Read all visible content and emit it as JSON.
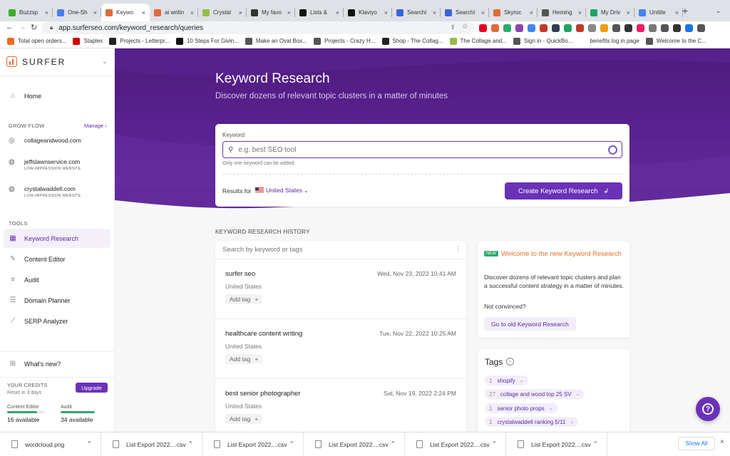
{
  "browser": {
    "tabs": [
      {
        "title": "Buzzsp",
        "color": "#3dae2b"
      },
      {
        "title": "One-Sh",
        "color": "#4a7cf0"
      },
      {
        "title": "Keywo",
        "color": "#e06b3a",
        "active": true
      },
      {
        "title": "ai writin",
        "color": "#e06b3a"
      },
      {
        "title": "Crystal",
        "color": "#95bf47"
      },
      {
        "title": "My favo",
        "color": "#333333"
      },
      {
        "title": "Lists &",
        "color": "#111111"
      },
      {
        "title": "Klaviyo",
        "color": "#111111"
      },
      {
        "title": "Searchi",
        "color": "#3b63d9"
      },
      {
        "title": "Searchi",
        "color": "#3b63d9"
      },
      {
        "title": "Skyroc",
        "color": "#e06b3a"
      },
      {
        "title": "Heming",
        "color": "#555555"
      },
      {
        "title": "My Driv",
        "color": "#1fa463"
      },
      {
        "title": "Untitle",
        "color": "#4285f4"
      }
    ],
    "new_tab": "+",
    "url": "app.surferseo.com/keyword_research/queries",
    "bookmarks": [
      {
        "label": "Total open orders...",
        "color": "#f26a21"
      },
      {
        "label": "Staples",
        "color": "#cc0000"
      },
      {
        "label": "Projects - Letterpr...",
        "color": "#222222"
      },
      {
        "label": "10 Steps For Givin...",
        "color": "#111111"
      },
      {
        "label": "Make an Oval Box...",
        "color": "#555555"
      },
      {
        "label": "Projects - Crazy H...",
        "color": "#555555"
      },
      {
        "label": "Shop - The Collag...",
        "color": "#222222"
      },
      {
        "label": "The Collage and...",
        "color": "#95bf47"
      },
      {
        "label": "Sign in - QuickBo...",
        "color": "#555555"
      },
      {
        "label": "benefits log in page",
        "color": "#ffffff"
      },
      {
        "label": "Welcome to the C...",
        "color": "#555555"
      }
    ]
  },
  "sidebar": {
    "logo": "SURFER",
    "home": "Home",
    "grow_flow_label": "GROW FLOW",
    "manage_link": "Manage",
    "sites": [
      {
        "name": "collageandwood.com",
        "sub": ""
      },
      {
        "name": "jeffslawnservice.com",
        "sub": "LOW-IMPRESSION WEBSITE"
      },
      {
        "name": "crystalwaddell.com",
        "sub": "LOW-IMPRESSION WEBSITE"
      }
    ],
    "tools_label": "TOOLS",
    "tools": [
      "Keyword Research",
      "Content Editor",
      "Audit",
      "Domain Planner",
      "SERP Analyzer"
    ],
    "whats_new": "What's new?",
    "credits_label": "YOUR CREDITS",
    "credits_reset": "Reset in 3 days",
    "upgrade": "Upgrade",
    "content_editor_label": "Content Editor",
    "content_editor_value": "16 available",
    "content_editor_fill": 0.8,
    "audit_label": "Audit",
    "audit_value": "34 available",
    "audit_fill": 1.0
  },
  "hero": {
    "title": "Keyword Research",
    "subtitle": "Discover dozens of relevant topic clusters in a matter of minutes"
  },
  "search": {
    "label": "Keyword",
    "placeholder": "e.g. best SEO tool",
    "hint": "Only one keyword can be added",
    "results_for": "Results for",
    "country": "United States",
    "create_button": "Create Keyword Research"
  },
  "history": {
    "heading": "KEYWORD RESEARCH HISTORY",
    "search_placeholder": "Search by keyword or tags",
    "add_tag": "Add tag",
    "items": [
      {
        "keyword": "surfer seo",
        "date": "Wed, Nov 23, 2022 10:41 AM",
        "country": "United States"
      },
      {
        "keyword": "healthcare content writing",
        "date": "Tue, Nov 22, 2022 10:25 AM",
        "country": "United States"
      },
      {
        "keyword": "best senior photographer",
        "date": "Sat, Nov 19, 2022 2:24 PM",
        "country": "United States"
      }
    ]
  },
  "promo": {
    "badge": "NEW",
    "title": "Welcome to the new Keyword Research",
    "body": "Discover dozens of relevant topic clusters and plan a successful content strategy in a matter of minutes.",
    "question": "Not convinced?",
    "button": "Go to old Keyword Research"
  },
  "tags": {
    "title": "Tags",
    "items": [
      {
        "count": "1",
        "name": "shopify"
      },
      {
        "count": "27",
        "name": "collage and wood top 25 SV"
      },
      {
        "count": "1",
        "name": "senior photo props"
      },
      {
        "count": "1",
        "name": "crystalwaddell ranking 5/11"
      }
    ]
  },
  "downloads": {
    "items": [
      "wordcloud.png",
      "List Export 2022....csv",
      "List Export 2022....csv",
      "List Export 2022....csv",
      "List Export 2022....csv",
      "List Export 2022....csv"
    ],
    "show_all": "Show All"
  },
  "colors": {
    "brand": "#5a2290",
    "accent": "#6b32b8",
    "promo_title": "#e8702a"
  }
}
